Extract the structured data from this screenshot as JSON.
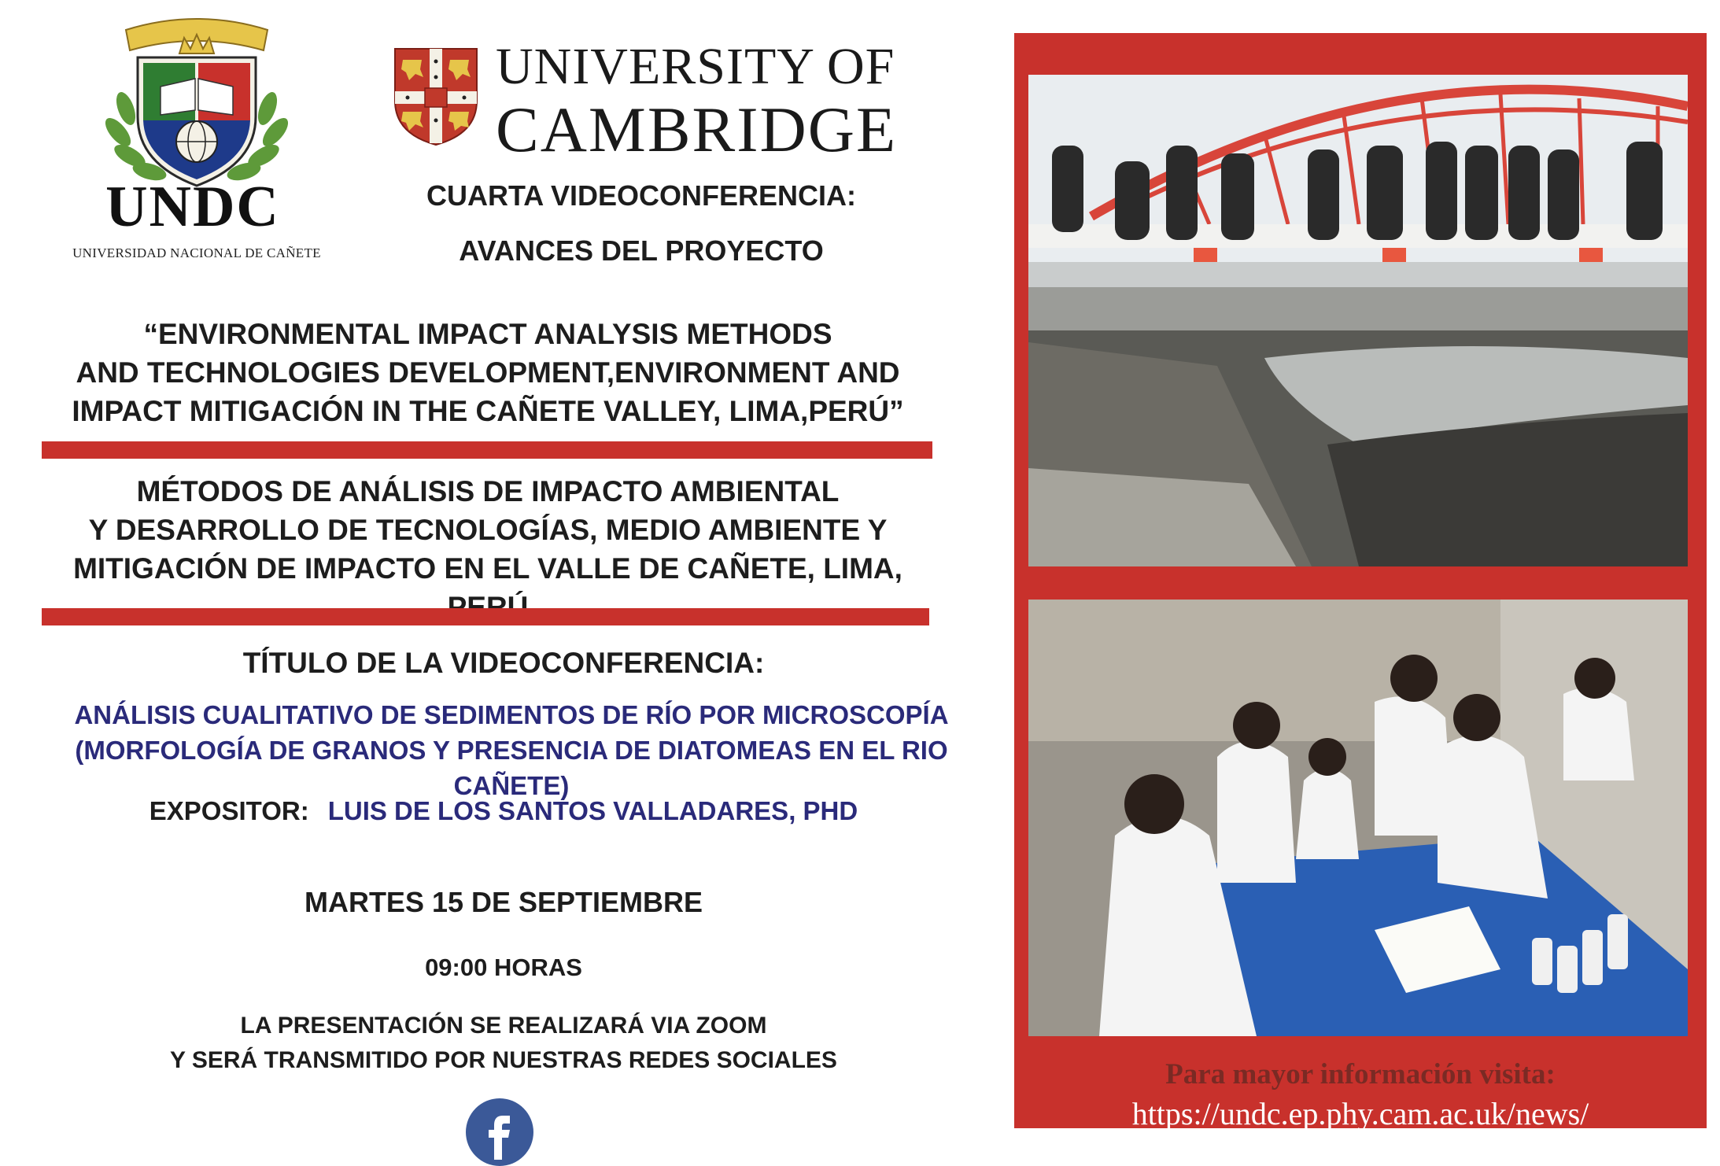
{
  "undc": {
    "name": "UNDC",
    "subtitle": "UNIVERSIDAD NACIONAL DE CAÑETE"
  },
  "cambridge": {
    "line1": "UNIVERSITY OF",
    "line2": "CAMBRIDGE"
  },
  "header": {
    "conference_number": "CUARTA VIDEOCONFERENCIA:",
    "conference_subject": "AVANCES DEL PROYECTO"
  },
  "project": {
    "title_en": [
      "“ENVIRONMENTAL IMPACT ANALYSIS METHODS",
      "AND TECHNOLOGIES DEVELOPMENT,ENVIRONMENT AND",
      "IMPACT MITIGACIÓN IN THE CAÑETE VALLEY, LIMA,PERÚ”"
    ],
    "title_es": [
      "MÉTODOS DE ANÁLISIS DE IMPACTO AMBIENTAL",
      "Y DESARROLLO DE TECNOLOGÍAS, MEDIO AMBIENTE Y",
      "MITIGACIÓN DE IMPACTO EN EL VALLE DE CAÑETE, LIMA, PERÚ"
    ]
  },
  "talk": {
    "label": "TÍTULO DE LA VIDEOCONFERENCIA:",
    "title": [
      "ANÁLISIS CUALITATIVO DE SEDIMENTOS DE RÍO POR MICROSCOPÍA",
      "(MORFOLOGÍA DE GRANOS Y PRESENCIA DE DIATOMEAS EN EL RIO CAÑETE)"
    ],
    "speaker_label": "EXPOSITOR:",
    "speaker_name": "LUIS DE LOS SANTOS VALLADARES, PHD"
  },
  "schedule": {
    "date": "MARTES 15 DE SEPTIEMBRE",
    "time": "09:00 HORAS",
    "note": [
      "LA PRESENTACIÓN SE REALIZARÁ VIA ZOOM",
      "Y SERÁ TRANSMITIDO POR NUESTRAS REDES SOCIALES"
    ]
  },
  "info": {
    "label": "Para mayor información visita:",
    "url": "https://undc.ep.phy.cam.ac.uk/news/"
  },
  "icons": {
    "facebook": "facebook-icon"
  },
  "colors": {
    "accent_red": "#c8312c",
    "subtitle_blue": "#2a2a7a",
    "facebook_blue": "#3b5998",
    "undc_green": "#2f7d32",
    "undc_gold": "#e6c54a",
    "cambridge_red": "#c0392b"
  }
}
